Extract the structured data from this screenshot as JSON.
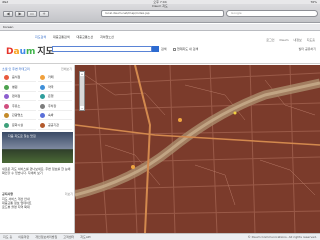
{
  "status": {
    "device": "iPad",
    "time": "오후 7:04",
    "battery": "76%"
  },
  "browser": {
    "page_title": "Daum 지도",
    "url": "local.daum.net/map/index.jsp",
    "search_placeholder": "Google",
    "back": "◀",
    "forward": "▶",
    "bookmarks_icon": "▭",
    "add_icon": "+",
    "bookmark_item": "Korean"
  },
  "daum": {
    "logo_d": "D",
    "logo_a": "a",
    "logo_u": "u",
    "logo_m": "m",
    "logo_map": "지도",
    "nav": [
      "지도검색",
      "대중교통검색",
      "대중교통노선",
      "지하철노선"
    ],
    "right_nav": [
      "로그인",
      "Daum",
      "내정보",
      "지도홈"
    ],
    "search_label": "검색",
    "check_label": "현재지도 내 검색",
    "tools_label": "필터",
    "share_label": "공유하기"
  },
  "panel": {
    "header": "소셜 인 주변 카테고리",
    "header_right": "전체보기",
    "categories": [
      {
        "label": "음식점",
        "color": "#e95a3d"
      },
      {
        "label": "카페",
        "color": "#f0a03c"
      },
      {
        "label": "병원",
        "color": "#4da24f"
      },
      {
        "label": "약국",
        "color": "#3f8fd8"
      },
      {
        "label": "편의점",
        "color": "#8d5fcf"
      },
      {
        "label": "은행",
        "color": "#2f9e9c"
      },
      {
        "label": "주유소",
        "color": "#d14f7f"
      },
      {
        "label": "주차장",
        "color": "#7d7d7d"
      },
      {
        "label": "관광명소",
        "color": "#c48b2a"
      },
      {
        "label": "숙박",
        "color": "#5a6fd8"
      },
      {
        "label": "문화시설",
        "color": "#3ea07a"
      },
      {
        "label": "공공기관",
        "color": "#b35a2d"
      }
    ],
    "promo_title": "다음 지도로 찾는 맛집",
    "promo_desc": "새로운 지도 서비스를 만나보세요. 주변 정보를 한 눈에 확인할 수 있습니다. 자세히 보기",
    "notice_header": "공지사항",
    "notice_more": "더보기",
    "notices": [
      "지도 서비스 개선 안내",
      "대중교통 정보 업데이트",
      "로드뷰 촬영 지역 확대"
    ]
  },
  "map": {
    "zoom_in": "+",
    "zoom_out": "−"
  },
  "footer": {
    "links": [
      "지도 홈",
      "이용약관",
      "개인정보처리방침",
      "고객센터",
      "지도API"
    ],
    "copyright": "© Daum Communications. All rights reserved."
  }
}
